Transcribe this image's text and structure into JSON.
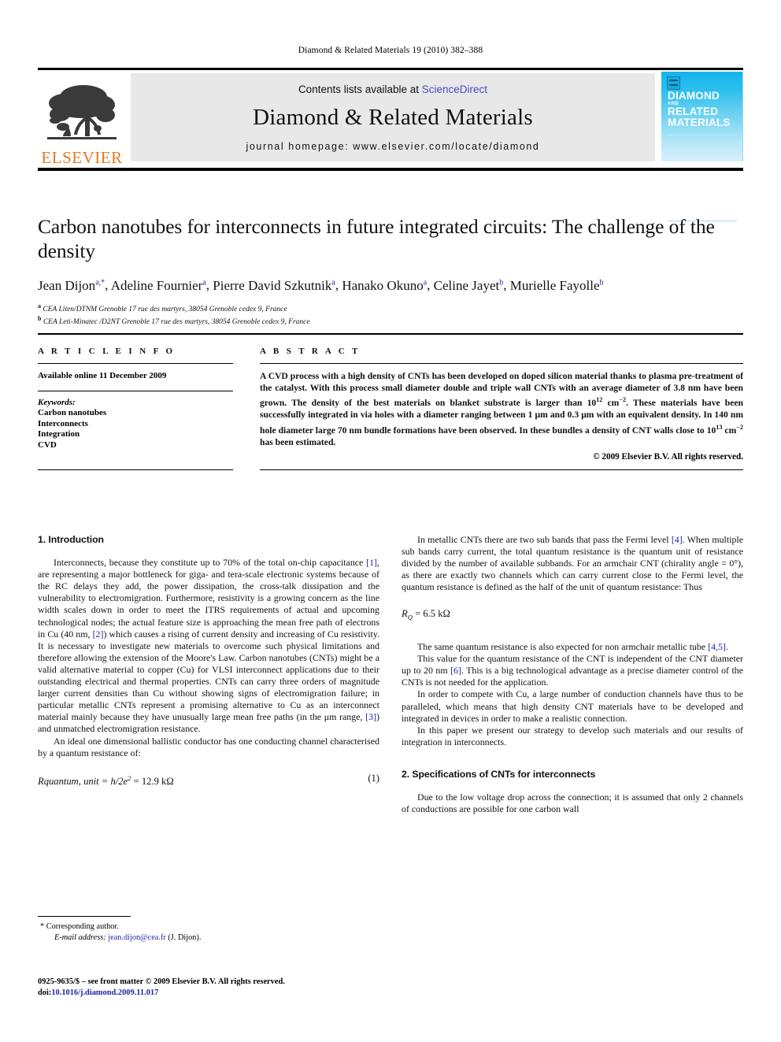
{
  "running_head": "Diamond & Related Materials 19 (2010) 382–388",
  "masthead": {
    "contents_prefix": "Contents lists available at ",
    "sciencedirect": "ScienceDirect",
    "journal_title": "Diamond & Related Materials",
    "homepage": "journal homepage: www.elsevier.com/locate/diamond",
    "publisher_wordmark": "ELSEVIER",
    "publisher_logo_icon": "elsevier-tree-icon",
    "cover": {
      "line1": "DIAMOND",
      "line2": "AND",
      "line3": "RELATED",
      "line4": "MATERIALS",
      "accent_color": "#14b4ea"
    },
    "link_color": "#4a4ac4"
  },
  "article": {
    "title": "Carbon nanotubes for interconnects in future integrated circuits: The challenge of the density",
    "authors": [
      {
        "name": "Jean Dijon",
        "marks": "a,*"
      },
      {
        "name": "Adeline Fournier",
        "marks": "a"
      },
      {
        "name": "Pierre David Szkutnik",
        "marks": "a"
      },
      {
        "name": "Hanako Okuno",
        "marks": "a"
      },
      {
        "name": "Celine Jayet",
        "marks": "b"
      },
      {
        "name": "Murielle Fayolle",
        "marks": "b"
      }
    ],
    "affiliations": [
      {
        "mark": "a",
        "text": "CEA Liten/DTNM Grenoble 17 rue des martyrs, 38054 Grenoble cedex 9, France"
      },
      {
        "mark": "b",
        "text": "CEA Leti-Minatec /D2NT Grenoble 17 rue des martyrs, 38054 Grenoble cedex 9, France"
      }
    ]
  },
  "article_info": {
    "heading": "A R T I C L E  I N F O",
    "history": "Available online 11 December 2009",
    "keywords_label": "Keywords:",
    "keywords": [
      "Carbon nanotubes",
      "Interconnects",
      "Integration",
      "CVD"
    ]
  },
  "abstract": {
    "heading": "A B S T R A C T",
    "paragraph_1": "A CVD process with a high density of CNTs has been developed on doped silicon material thanks to plasma pre-treatment of the catalyst. With this process small diameter double and triple wall CNTs with an average diameter of 3.8 nm have been grown. The density of the best materials on blanket substrate is larger than ",
    "density_1_base": "10",
    "density_1_exp": "12",
    "unit_base": " cm",
    "unit_exp": "−2",
    "paragraph_2": ". These materials have been successfully integrated in via holes with a diameter ranging between 1 μm and 0.3 μm with an equivalent density. In 140 nm hole diameter large 70 nm bundle formations have been observed. In these bundles a density of CNT walls close to ",
    "density_2_base": "10",
    "density_2_exp": "13",
    "paragraph_3": " has been estimated.",
    "copyright": "© 2009 Elsevier B.V. All rights reserved."
  },
  "body": {
    "section_1_heading": "1. Introduction",
    "p1_a": "Interconnects, because they constitute up to 70% of the total on-chip capacitance ",
    "p1_ref1": "[1]",
    "p1_b": ", are representing a major bottleneck for giga- and tera-scale electronic systems because of the RC delays they add, the power dissipation, the cross-talk dissipation and the vulnerability to electromigration. Furthermore, resistivity is a growing concern as the line width scales down in order to meet the ITRS requirements of actual and upcoming technological nodes; the actual feature size is approaching the mean free path of electrons in Cu (40 nm, ",
    "p1_ref2": "[2]",
    "p1_c": ") which causes a rising of current density and increasing of Cu resistivity. It is necessary to investigate new materials to overcome such physical limitations and therefore allowing the extension of the Moore's Law. Carbon nanotubes (CNTs) might be a valid alternative material to copper (Cu) for VLSI interconnect applications due to their outstanding electrical and thermal properties. CNTs can carry three orders of magnitude larger current densities than Cu without showing signs of electromigration failure; in particular metallic CNTs represent a promising alternative to Cu as an interconnect material mainly because they have unusually large mean free paths (in the μm range, ",
    "p1_ref3": "[3]",
    "p1_d": ") and unmatched electromigration resistance.",
    "p2": "An ideal one dimensional ballistic conductor has one conducting channel characterised by a quantum resistance of:",
    "eq1_lhs": "Rquantum, unit",
    "eq1_mid": " = h/2e",
    "eq1_exp": "2",
    "eq1_rhs": " = 12.9 kΩ",
    "eq1_number": "(1)",
    "p3_a": "In metallic CNTs there are two sub bands that pass the Fermi level ",
    "p3_ref4": "[4]",
    "p3_b": ". When multiple sub bands carry current, the total quantum resistance is the quantum unit of resistance divided by the number of available subbands. For an armchair CNT (chirality angle = 0°), as there are exactly two channels which can carry current close to the Fermi level, the quantum resistance is defined as the half of the unit of quantum resistance: Thus",
    "eq2_lhs": "R",
    "eq2_sub": "Q",
    "eq2_rhs": " = 6.5 kΩ",
    "p4_a": "The same quantum resistance is also expected for non armchair metallic tube ",
    "p4_ref": "[4,5]",
    "p4_b": ".",
    "p5_a": "This value for the quantum resistance of the CNT is independent of the CNT diameter up to 20 nm ",
    "p5_ref": "[6]",
    "p5_b": ". This is a big technological advantage as a precise diameter control of the CNTs is not needed for the application.",
    "p6": "In order to compete with Cu, a large number of conduction channels have thus to be paralleled, which means that high density CNT materials have to be developed and integrated in devices in order to make a realistic connection.",
    "p7": "In this paper we present our strategy to develop such materials and our results of integration in interconnects.",
    "section_2_heading": "2. Specifications of CNTs for interconnects",
    "p8": "Due to the low voltage drop across the connection; it is assumed that only 2 channels of conductions are possible for one carbon wall"
  },
  "footer": {
    "corresponding_label": "* Corresponding author.",
    "email_label": "E-mail address: ",
    "email": "jean.dijon@cea.fr",
    "email_suffix": " (J. Dijon).",
    "issn_line": "0925-9635/$ – see front matter © 2009 Elsevier B.V. All rights reserved.",
    "doi_label": "doi:",
    "doi": "10.1016/j.diamond.2009.11.017"
  }
}
